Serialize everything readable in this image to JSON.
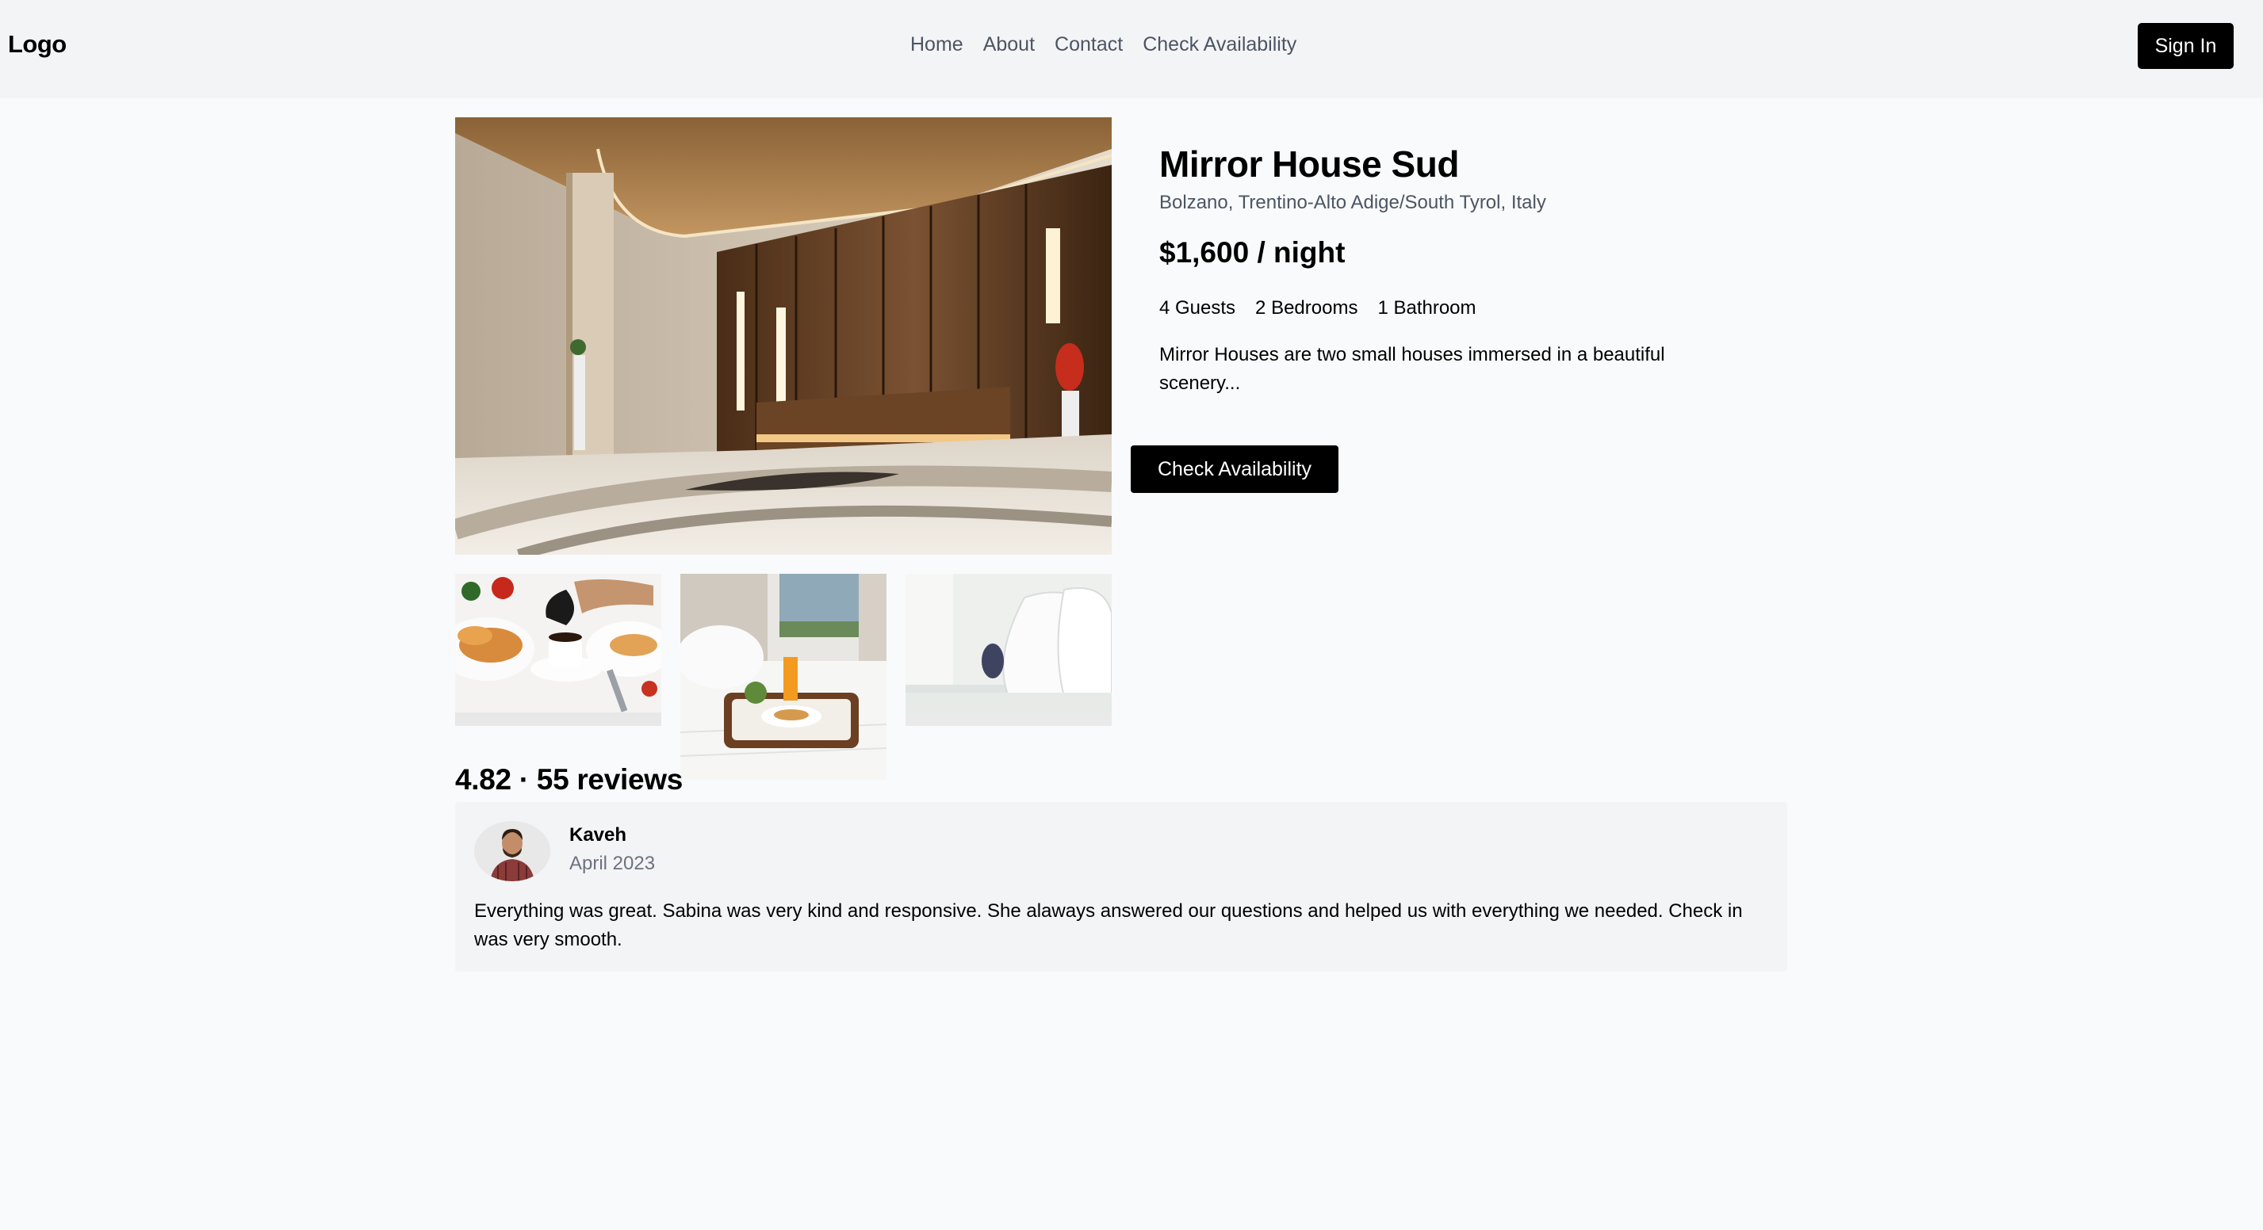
{
  "header": {
    "logo": "Logo",
    "nav": [
      "Home",
      "About",
      "Contact",
      "Check Availability"
    ],
    "sign_in": "Sign In"
  },
  "listing": {
    "title": "Mirror House Sud",
    "location": "Bolzano, Trentino-Alto Adige/South Tyrol, Italy",
    "price": "$1,600 / night",
    "specs": [
      "4 Guests",
      "2 Bedrooms",
      "1 Bathroom"
    ],
    "description": "Mirror Houses are two small houses immersed in a beautiful scenery...",
    "cta": "Check Availability"
  },
  "reviews": {
    "summary": "4.82 · 55 reviews",
    "items": [
      {
        "name": "Kaveh",
        "date": "April 2023",
        "text": "Everything was great. Sabina was very kind and responsive. She alaways answered our questions and helped us with everything we needed. Check in was very smooth."
      }
    ]
  },
  "colors": {
    "accent": "#000000",
    "header_bg": "#f3f4f6",
    "page_bg": "#f9fafb"
  }
}
